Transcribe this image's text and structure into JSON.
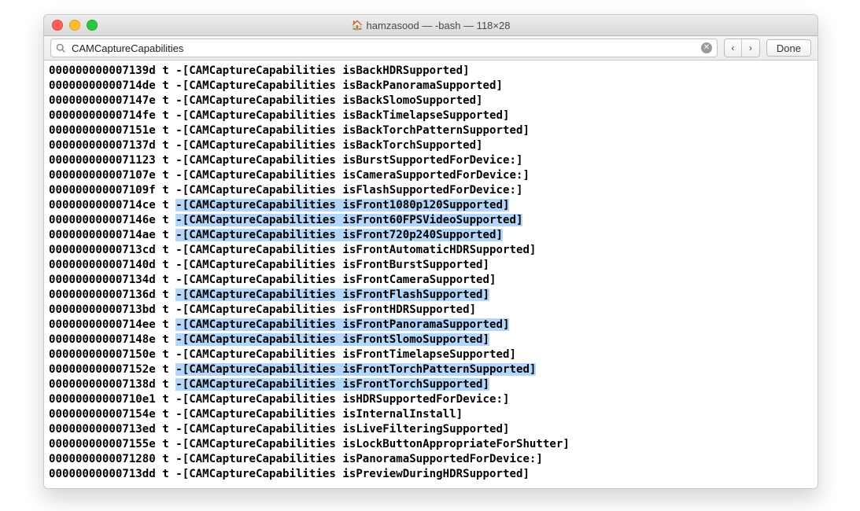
{
  "window": {
    "title": "hamzasood — -bash — 118×28"
  },
  "findbar": {
    "search_value": "CAMCaptureCapabilities",
    "done_label": "Done"
  },
  "lines": [
    {
      "addr": "000000000007139d",
      "flag": "t",
      "method": "-[CAMCaptureCapabilities isBackHDRSupported]",
      "highlighted": false
    },
    {
      "addr": "00000000000714de",
      "flag": "t",
      "method": "-[CAMCaptureCapabilities isBackPanoramaSupported]",
      "highlighted": false
    },
    {
      "addr": "000000000007147e",
      "flag": "t",
      "method": "-[CAMCaptureCapabilities isBackSlomoSupported]",
      "highlighted": false
    },
    {
      "addr": "00000000000714fe",
      "flag": "t",
      "method": "-[CAMCaptureCapabilities isBackTimelapseSupported]",
      "highlighted": false
    },
    {
      "addr": "000000000007151e",
      "flag": "t",
      "method": "-[CAMCaptureCapabilities isBackTorchPatternSupported]",
      "highlighted": false
    },
    {
      "addr": "000000000007137d",
      "flag": "t",
      "method": "-[CAMCaptureCapabilities isBackTorchSupported]",
      "highlighted": false
    },
    {
      "addr": "0000000000071123",
      "flag": "t",
      "method": "-[CAMCaptureCapabilities isBurstSupportedForDevice:]",
      "highlighted": false
    },
    {
      "addr": "000000000007107e",
      "flag": "t",
      "method": "-[CAMCaptureCapabilities isCameraSupportedForDevice:]",
      "highlighted": false
    },
    {
      "addr": "000000000007109f",
      "flag": "t",
      "method": "-[CAMCaptureCapabilities isFlashSupportedForDevice:]",
      "highlighted": false
    },
    {
      "addr": "00000000000714ce",
      "flag": "t",
      "method": "-[CAMCaptureCapabilities isFront1080p120Supported]",
      "highlighted": true
    },
    {
      "addr": "000000000007146e",
      "flag": "t",
      "method": "-[CAMCaptureCapabilities isFront60FPSVideoSupported]",
      "highlighted": true
    },
    {
      "addr": "00000000000714ae",
      "flag": "t",
      "method": "-[CAMCaptureCapabilities isFront720p240Supported]",
      "highlighted": true
    },
    {
      "addr": "00000000000713cd",
      "flag": "t",
      "method": "-[CAMCaptureCapabilities isFrontAutomaticHDRSupported]",
      "highlighted": false
    },
    {
      "addr": "000000000007140d",
      "flag": "t",
      "method": "-[CAMCaptureCapabilities isFrontBurstSupported]",
      "highlighted": false
    },
    {
      "addr": "000000000007134d",
      "flag": "t",
      "method": "-[CAMCaptureCapabilities isFrontCameraSupported]",
      "highlighted": false
    },
    {
      "addr": "000000000007136d",
      "flag": "t",
      "method": "-[CAMCaptureCapabilities isFrontFlashSupported]",
      "highlighted": true
    },
    {
      "addr": "00000000000713bd",
      "flag": "t",
      "method": "-[CAMCaptureCapabilities isFrontHDRSupported]",
      "highlighted": false
    },
    {
      "addr": "00000000000714ee",
      "flag": "t",
      "method": "-[CAMCaptureCapabilities isFrontPanoramaSupported]",
      "highlighted": true
    },
    {
      "addr": "000000000007148e",
      "flag": "t",
      "method": "-[CAMCaptureCapabilities isFrontSlomoSupported]",
      "highlighted": true
    },
    {
      "addr": "000000000007150e",
      "flag": "t",
      "method": "-[CAMCaptureCapabilities isFrontTimelapseSupported]",
      "highlighted": false
    },
    {
      "addr": "000000000007152e",
      "flag": "t",
      "method": "-[CAMCaptureCapabilities isFrontTorchPatternSupported]",
      "highlighted": true
    },
    {
      "addr": "000000000007138d",
      "flag": "t",
      "method": "-[CAMCaptureCapabilities isFrontTorchSupported]",
      "highlighted": true
    },
    {
      "addr": "00000000000710e1",
      "flag": "t",
      "method": "-[CAMCaptureCapabilities isHDRSupportedForDevice:]",
      "highlighted": false
    },
    {
      "addr": "000000000007154e",
      "flag": "t",
      "method": "-[CAMCaptureCapabilities isInternalInstall]",
      "highlighted": false
    },
    {
      "addr": "00000000000713ed",
      "flag": "t",
      "method": "-[CAMCaptureCapabilities isLiveFilteringSupported]",
      "highlighted": false
    },
    {
      "addr": "000000000007155e",
      "flag": "t",
      "method": "-[CAMCaptureCapabilities isLockButtonAppropriateForShutter]",
      "highlighted": false
    },
    {
      "addr": "0000000000071280",
      "flag": "t",
      "method": "-[CAMCaptureCapabilities isPanoramaSupportedForDevice:]",
      "highlighted": false
    },
    {
      "addr": "00000000000713dd",
      "flag": "t",
      "method": "-[CAMCaptureCapabilities isPreviewDuringHDRSupported]",
      "highlighted": false
    }
  ]
}
